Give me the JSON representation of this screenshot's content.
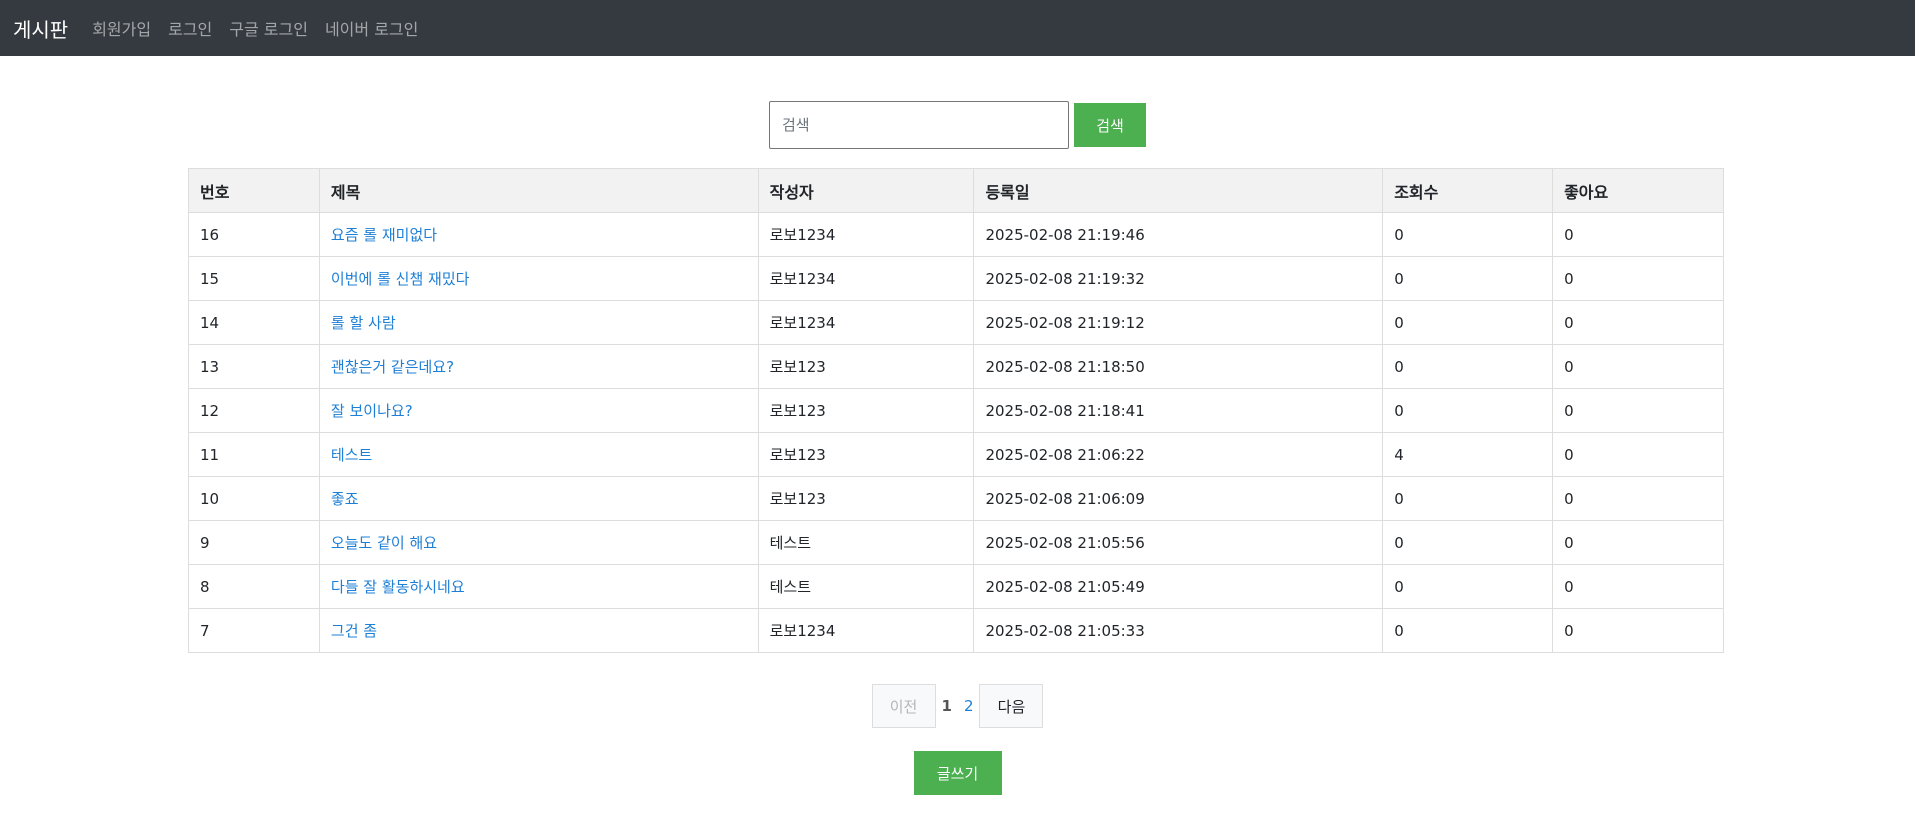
{
  "navbar": {
    "brand": "게시판",
    "links": [
      "회원가입",
      "로그인",
      "구글 로그인",
      "네이버 로그인"
    ]
  },
  "search": {
    "placeholder": "검색",
    "value": "",
    "button_label": "검색"
  },
  "table": {
    "headers": [
      "번호",
      "제목",
      "작성자",
      "등록일",
      "조회수",
      "좋아요"
    ],
    "rows": [
      {
        "no": "16",
        "title": "요즘 롤 재미없다",
        "author": "로보1234",
        "date": "2025-02-08 21:19:46",
        "views": "0",
        "likes": "0"
      },
      {
        "no": "15",
        "title": "이번에 롤 신챔 재밌다",
        "author": "로보1234",
        "date": "2025-02-08 21:19:32",
        "views": "0",
        "likes": "0"
      },
      {
        "no": "14",
        "title": "롤 할 사람",
        "author": "로보1234",
        "date": "2025-02-08 21:19:12",
        "views": "0",
        "likes": "0"
      },
      {
        "no": "13",
        "title": "괜찮은거 같은데요?",
        "author": "로보123",
        "date": "2025-02-08 21:18:50",
        "views": "0",
        "likes": "0"
      },
      {
        "no": "12",
        "title": "잘 보이나요?",
        "author": "로보123",
        "date": "2025-02-08 21:18:41",
        "views": "0",
        "likes": "0"
      },
      {
        "no": "11",
        "title": "테스트",
        "author": "로보123",
        "date": "2025-02-08 21:06:22",
        "views": "4",
        "likes": "0"
      },
      {
        "no": "10",
        "title": "좋죠",
        "author": "로보123",
        "date": "2025-02-08 21:06:09",
        "views": "0",
        "likes": "0"
      },
      {
        "no": "9",
        "title": "오늘도 같이 해요",
        "author": "테스트",
        "date": "2025-02-08 21:05:56",
        "views": "0",
        "likes": "0"
      },
      {
        "no": "8",
        "title": "다들 잘 활동하시네요",
        "author": "테스트",
        "date": "2025-02-08 21:05:49",
        "views": "0",
        "likes": "0"
      },
      {
        "no": "7",
        "title": "그건 좀",
        "author": "로보1234",
        "date": "2025-02-08 21:05:33",
        "views": "0",
        "likes": "0"
      }
    ]
  },
  "pagination": {
    "prev_label": "이전",
    "pages": [
      "1",
      "2"
    ],
    "current": "1",
    "next_label": "다음"
  },
  "write_button_label": "글쓰기",
  "colors": {
    "navbar_bg": "#343a40",
    "accent_green": "#4caf50",
    "link_blue": "#1e7fd6"
  }
}
